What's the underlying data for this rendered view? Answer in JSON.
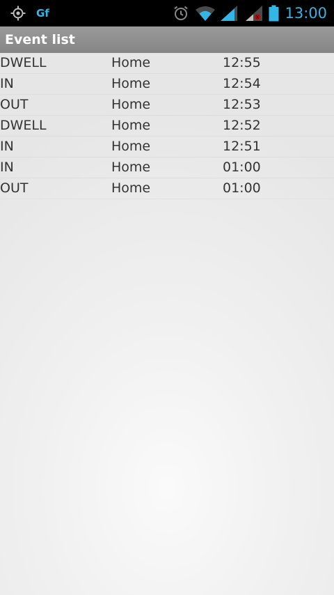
{
  "status_bar": {
    "app_label": "Gf",
    "time": "13:00",
    "accent_color": "#33b5e5",
    "icons": [
      "gps-icon",
      "alarm-icon",
      "wifi-icon",
      "signal-icon",
      "signal-roaming-icon",
      "battery-icon"
    ]
  },
  "action_bar": {
    "title": "Event list"
  },
  "events": [
    {
      "type": "DWELL",
      "place": "Home",
      "time": "12:55"
    },
    {
      "type": "IN",
      "place": "Home",
      "time": "12:54"
    },
    {
      "type": "OUT",
      "place": "Home",
      "time": "12:53"
    },
    {
      "type": "DWELL",
      "place": "Home",
      "time": "12:52"
    },
    {
      "type": "IN",
      "place": "Home",
      "time": "12:51"
    },
    {
      "type": "IN",
      "place": "Home",
      "time": "01:00"
    },
    {
      "type": "OUT",
      "place": "Home",
      "time": "01:00"
    }
  ]
}
